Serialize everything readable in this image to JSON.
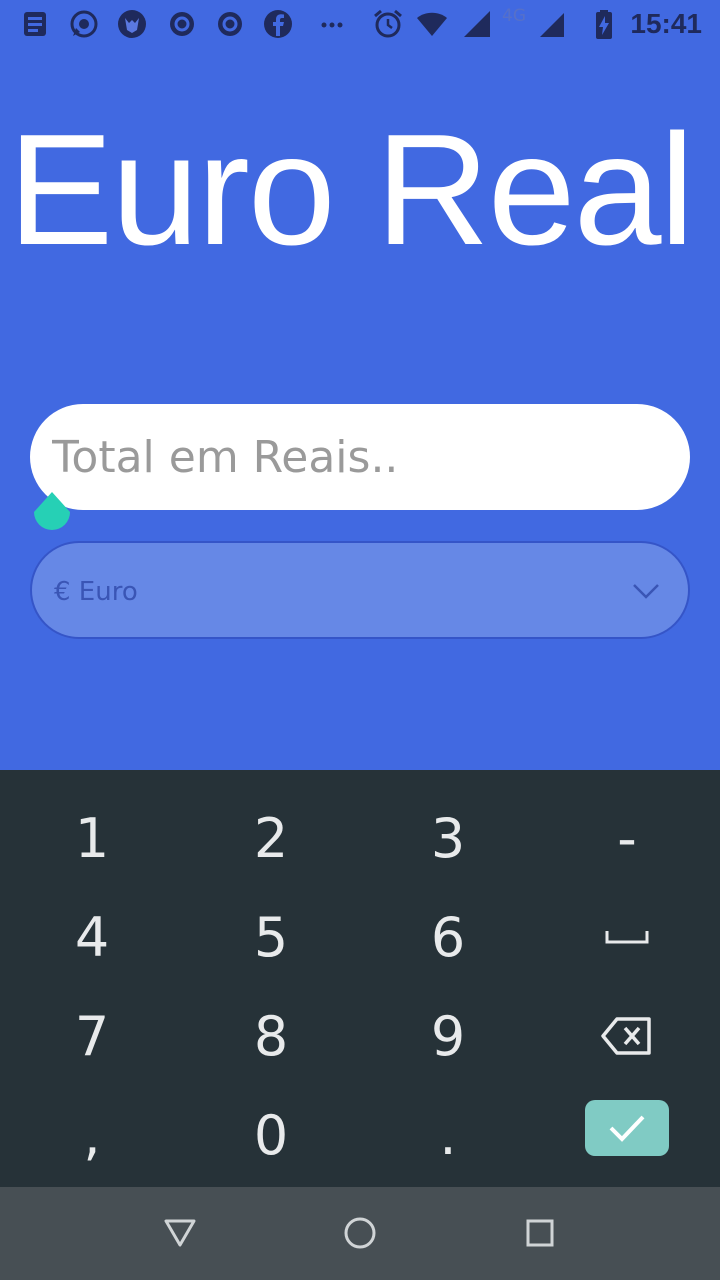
{
  "status_bar": {
    "time": "15:41",
    "network": "4G",
    "icons": [
      "news-icon",
      "whatsapp-icon",
      "fox-app-icon",
      "c-icon",
      "c-icon",
      "facebook-icon",
      "more-icon",
      "alarm-icon",
      "wifi-icon",
      "signal-icon",
      "signal-icon",
      "battery-charging-icon"
    ]
  },
  "app": {
    "title": "Euro Real",
    "amount_placeholder": "Total em Reais..",
    "currency_selected": "€ Euro"
  },
  "keyboard": {
    "keys": [
      "1",
      "2",
      "3",
      "-",
      "4",
      "5",
      "6",
      "␣",
      "7",
      "8",
      "9",
      "backspace",
      ",",
      "0",
      ".",
      "enter"
    ]
  },
  "colors": {
    "background": "#4169e1",
    "input": "#ffffff",
    "select": "#6688e6",
    "keyboard": "#263238",
    "enter": "#80cbc4",
    "navbar": "#474f54",
    "cursor_handle": "#26d0b5"
  }
}
